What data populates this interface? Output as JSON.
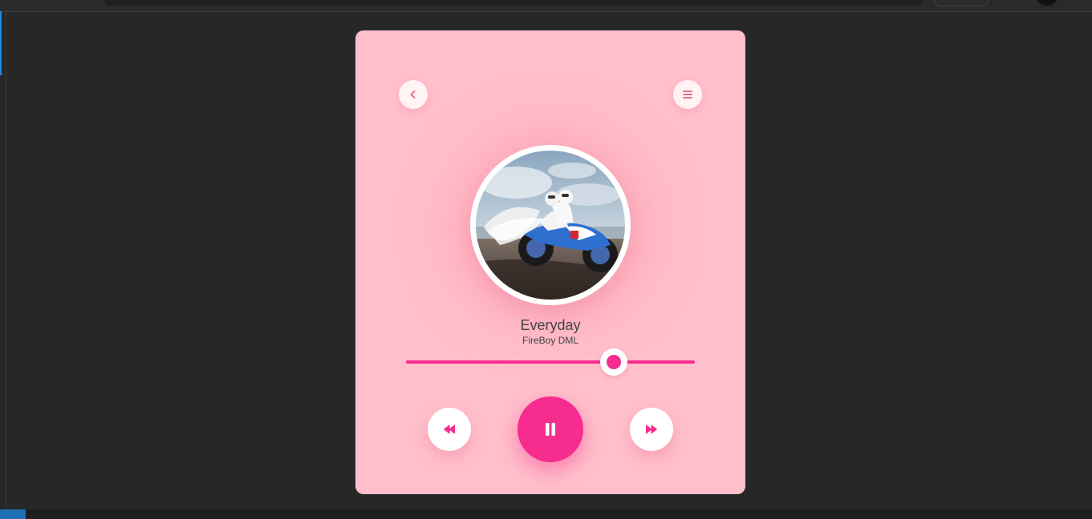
{
  "player": {
    "song_title": "Everyday",
    "artist": "FireBoy DML",
    "progress_fraction": 0.72,
    "album_art_alt": "",
    "icons": {
      "back": "chevron-left-icon",
      "menu": "hamburger-menu-icon",
      "previous": "rewind-icon",
      "play_pause": "pause-icon",
      "next": "fast-forward-icon"
    },
    "colors": {
      "card_background": "#ffbfcb",
      "accent": "#f72c8f",
      "button_background": "#ffffff",
      "text": "#444444"
    }
  }
}
